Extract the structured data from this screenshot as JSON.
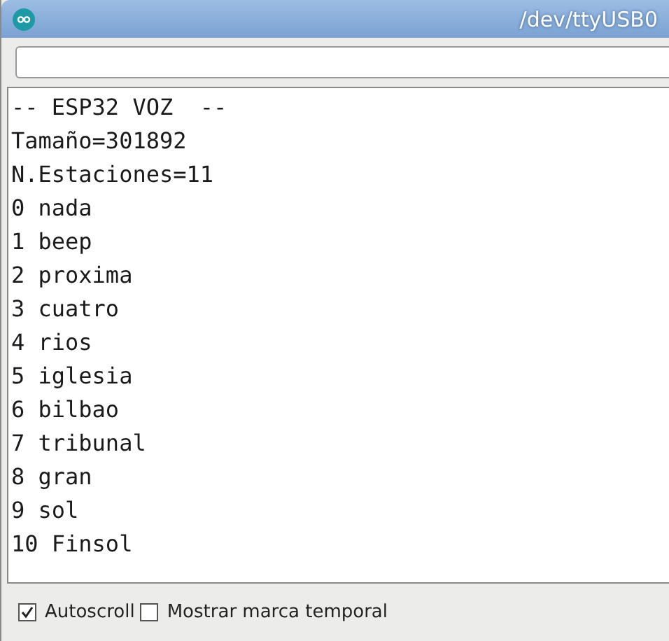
{
  "window": {
    "title": "/dev/ttyUSB0"
  },
  "output_lines": [
    "-- ESP32 VOZ  --",
    "Tamaño=301892",
    "N.Estaciones=11",
    "0 nada",
    "1 beep",
    "2 proxima",
    "3 cuatro",
    "4 rios",
    "5 iglesia",
    "6 bilbao",
    "7 tribunal",
    "8 gran",
    "9 sol",
    "10 Finsol"
  ],
  "options": [
    {
      "label": "Autoscroll",
      "checked": true
    },
    {
      "label": "Mostrar marca temporal",
      "checked": false
    }
  ]
}
